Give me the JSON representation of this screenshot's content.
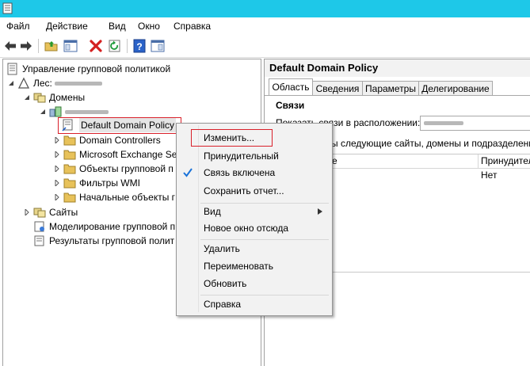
{
  "menu": [
    "Файл",
    "Действие",
    "Вид",
    "Окно",
    "Справка"
  ],
  "toolbar": {
    "icons": [
      "back-icon",
      "forward-icon",
      "up-folder-icon",
      "show-hide-tree-icon",
      "delete-icon",
      "refresh-icon",
      "help-icon",
      "properties-icon"
    ]
  },
  "tree": {
    "root": "Управление групповой политикой",
    "forest": "Лес:",
    "domains": "Домены",
    "items": [
      "Default Domain Policy",
      "Domain Controllers",
      "Microsoft Exchange Se",
      "Объекты групповой п",
      "Фильтры WMI",
      "Начальные объекты г"
    ],
    "sites": "Сайты",
    "modeling": "Моделирование групповой п",
    "results": "Результаты групповой полит"
  },
  "right": {
    "title": "Default Domain Policy",
    "tabs": [
      "Область",
      "Сведения",
      "Параметры",
      "Делегирование"
    ],
    "links_heading": "Связи",
    "show_links_label": "Показать связи в расположении:",
    "linked_text": "ы следующие сайты, домены и подразделения:",
    "col_location": "е",
    "col_enforced": "Принудитель",
    "row_enforced": "Нет"
  },
  "context_menu": {
    "items": [
      "Изменить...",
      "Принудительный",
      "Связь включена",
      "Сохранить отчет...",
      "Вид",
      "Новое окно отсюда",
      "Удалить",
      "Переименовать",
      "Обновить",
      "Справка"
    ],
    "checked": "Связь включена",
    "submenu": "Вид"
  },
  "colors": {
    "titlebar": "#1ec8e8",
    "highlight": "#d9202a",
    "check": "#1a73d9"
  }
}
